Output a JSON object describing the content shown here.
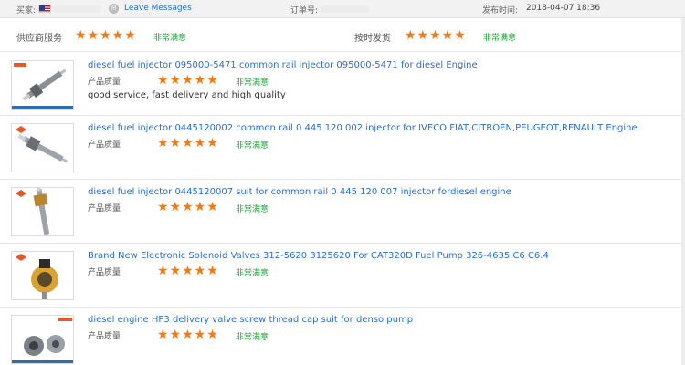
{
  "topbar": {
    "buyer_label": "买家:",
    "leave_messages": "Leave Messages",
    "order_label": "订单号:",
    "ship_label": "发布时间:",
    "ship_time": "2018-04-07 18:36"
  },
  "summary": {
    "supplier_service_label": "供应商服务",
    "supplier_service_rating": "★★★★★",
    "supplier_service_text": "非常满意",
    "on_time_label": "按时发货",
    "on_time_rating": "★★★★★",
    "on_time_text": "非常满意"
  },
  "colors": {
    "star": "#f7780e",
    "link": "#2a6ecb",
    "satisfied": "#1fa33b"
  },
  "reviews": [
    {
      "title": "diesel fuel injector 095000-5471 common rail injector 095000-5471 for diesel Engine",
      "quality_label": "产品质量",
      "rating": "★★★★★",
      "rating_text": "非常满意",
      "comment": "good service, fast delivery and high quality",
      "thumb_icon": "fuel-injector-icon"
    },
    {
      "title": "diesel fuel injector 0445120002 common rail 0 445 120 002 injector for IVECO,FIAT,CITROEN,PEUGEOT,RENAULT Engine",
      "quality_label": "产品质量",
      "rating": "★★★★★",
      "rating_text": "非常满意",
      "comment": "",
      "thumb_icon": "fuel-injector-icon"
    },
    {
      "title": "diesel fuel injector 0445120007 suit for common rail 0 445 120 007 injector fordiesel engine",
      "quality_label": "产品质量",
      "rating": "★★★★★",
      "rating_text": "非常满意",
      "comment": "",
      "thumb_icon": "fuel-injector-icon"
    },
    {
      "title": "Brand New Electronic Solenoid Valves 312-5620 3125620 For CAT320D Fuel Pump 326-4635 C6 C6.4",
      "quality_label": "产品质量",
      "rating": "★★★★★",
      "rating_text": "非常满意",
      "comment": "",
      "thumb_icon": "solenoid-valve-icon"
    },
    {
      "title": "diesel engine HP3 delivery valve screw thread cap suit for denso pump",
      "quality_label": "产品质量",
      "rating": "★★★★★",
      "rating_text": "非常满意",
      "comment": "",
      "thumb_icon": "valve-cap-icon"
    }
  ]
}
